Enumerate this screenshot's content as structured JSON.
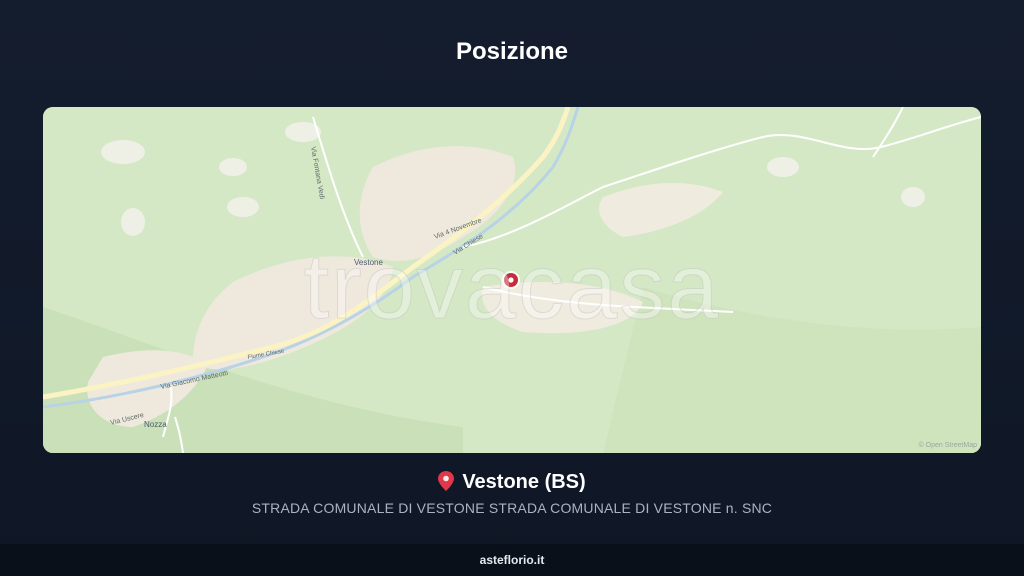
{
  "header": {
    "title": "Posizione"
  },
  "map": {
    "watermark": "trovacasa",
    "attribution": "© Open StreetMap",
    "towns": [
      "Vestone",
      "Nozza"
    ],
    "streets": [
      "Via 4 Novembre",
      "Via Chiese",
      "Via Fontana Vedi",
      "Via Giacomo Matteotti",
      "Via Uscere",
      "Fiume Chiese"
    ],
    "colors": {
      "land": "#d6e9c6",
      "urban": "#f3ede4",
      "road": "#fff9d6",
      "marker": "#c62d3a"
    }
  },
  "location": {
    "icon": "pin-icon",
    "place": "Vestone (BS)",
    "address": "STRADA COMUNALE DI VESTONE STRADA COMUNALE DI VESTONE n. SNC"
  },
  "footer": {
    "site": "asteflorio.it"
  }
}
